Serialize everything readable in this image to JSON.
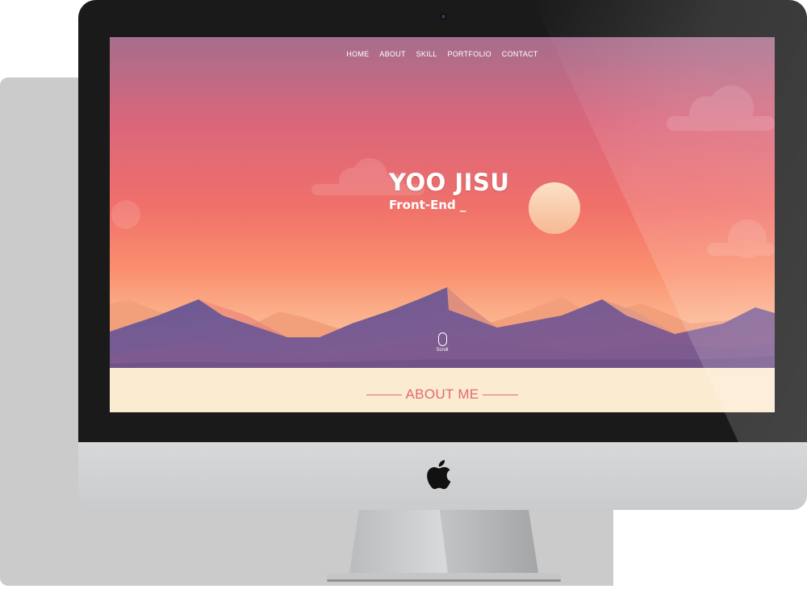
{
  "site": {
    "nav": [
      "HOME",
      "ABOUT",
      "SKILL",
      "PORTFOLIO",
      "CONTACT"
    ],
    "hero": {
      "title": "YOO JISU",
      "subtitle": "Front-End _",
      "scroll_label": "Scroll"
    },
    "about": {
      "title": "ABOUT ME"
    }
  },
  "colors": {
    "accent": "#e06a6f",
    "about_bg": "#fbebd0",
    "bezel": "#1a1a1a"
  },
  "icons": {
    "brand": "apple-logo-icon",
    "scroll": "mouse-scroll-icon"
  }
}
